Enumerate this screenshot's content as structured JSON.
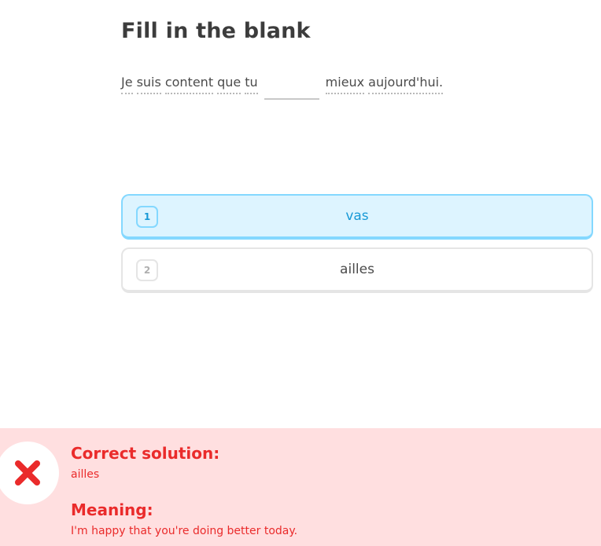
{
  "exercise": {
    "title": "Fill in the blank",
    "sentence_before": [
      "Je",
      "suis",
      "content",
      "que",
      "tu"
    ],
    "sentence_after": [
      "mieux",
      "aujourd'hui."
    ]
  },
  "choices": [
    {
      "key": "1",
      "label": "vas",
      "selected": true
    },
    {
      "key": "2",
      "label": "ailles",
      "selected": false
    }
  ],
  "feedback": {
    "status": "incorrect",
    "icon": "close-icon",
    "solution_heading": "Correct solution:",
    "solution_text": "ailles",
    "meaning_heading": "Meaning:",
    "meaning_text": "I'm happy that you're doing better today."
  },
  "colors": {
    "selected_background": "#ddf4ff",
    "selected_border": "#84d8ff",
    "selected_text": "#1899d6",
    "feedback_background": "#ffdfe0",
    "error_red": "#ea2b2b"
  }
}
